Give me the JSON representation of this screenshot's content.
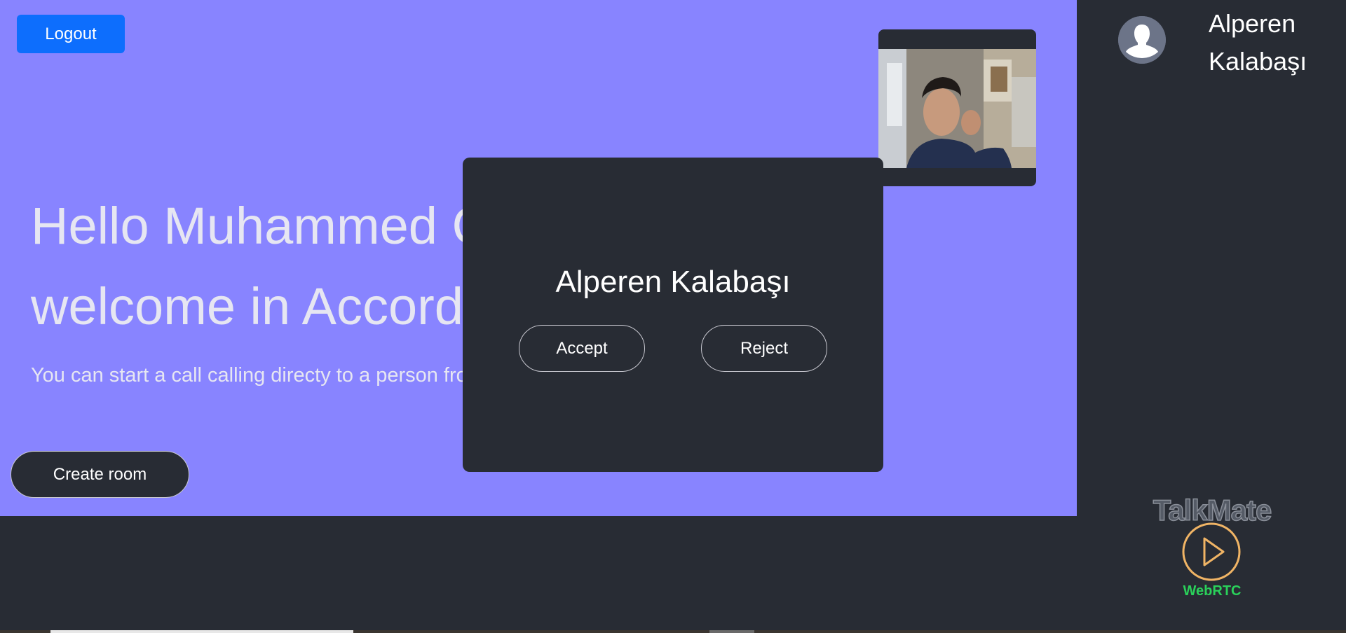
{
  "header": {
    "logout_label": "Logout"
  },
  "hero": {
    "greeting": "Hello Muhammed Can Küçükaslan, welcome in AccordBox.",
    "description": "You can start a call calling directy to a person from the list on the right or create a group call.",
    "create_room_label": "Create room"
  },
  "sidebar": {
    "contacts": [
      {
        "name": "Alperen Kalabaşı",
        "avatar_icon": "user-silhouette-icon"
      }
    ]
  },
  "brand": {
    "title": "TalkMate",
    "subtitle": "WebRTC",
    "icon": "play-circle-icon",
    "accent_color": "#f0b465",
    "subtitle_color": "#2ad15a"
  },
  "incoming_call": {
    "caller_name": "Alperen Kalabaşı",
    "accept_label": "Accept",
    "reject_label": "Reject"
  },
  "colors": {
    "hero_background": "#8884ff",
    "dark_background": "#282c34",
    "logout_button": "#0d6efd"
  }
}
